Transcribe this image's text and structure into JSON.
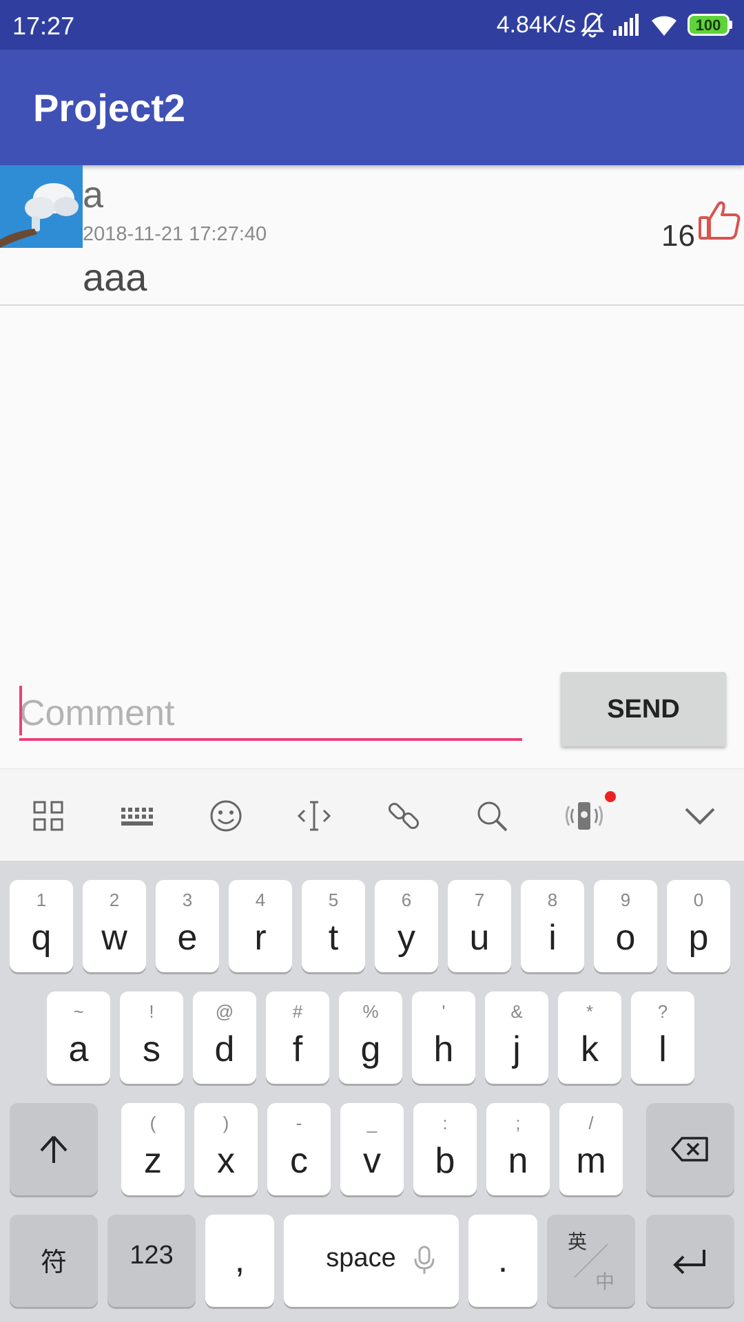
{
  "status_bar": {
    "time": "17:27",
    "net_speed": "4.84K/s",
    "battery": "100",
    "icons": [
      "mute-bell-icon",
      "signal-icon",
      "wifi-icon",
      "battery-icon"
    ]
  },
  "app_bar": {
    "title": "Project2"
  },
  "comment": {
    "user": "a",
    "time": "2018-11-21 17:27:40",
    "text": "aaa",
    "like_count": "16",
    "like_icon": "thumbs-up-icon"
  },
  "input": {
    "placeholder": "Comment",
    "value": ""
  },
  "send_button": {
    "label": "SEND"
  },
  "keyboard_toolbar": {
    "icons": [
      "grid-apps-icon",
      "keyboard-icon",
      "emoji-icon",
      "text-cursor-icon",
      "clip-link-icon",
      "search-icon",
      "phone-vibrate-icon",
      "collapse-chevron-icon"
    ]
  },
  "keyboard": {
    "row1": [
      {
        "k": "q",
        "s": "1"
      },
      {
        "k": "w",
        "s": "2"
      },
      {
        "k": "e",
        "s": "3"
      },
      {
        "k": "r",
        "s": "4"
      },
      {
        "k": "t",
        "s": "5"
      },
      {
        "k": "y",
        "s": "6"
      },
      {
        "k": "u",
        "s": "7"
      },
      {
        "k": "i",
        "s": "8"
      },
      {
        "k": "o",
        "s": "9"
      },
      {
        "k": "p",
        "s": "0"
      }
    ],
    "row2": [
      {
        "k": "a",
        "s": "~"
      },
      {
        "k": "s",
        "s": "!"
      },
      {
        "k": "d",
        "s": "@"
      },
      {
        "k": "f",
        "s": "#"
      },
      {
        "k": "g",
        "s": "%"
      },
      {
        "k": "h",
        "s": "'"
      },
      {
        "k": "j",
        "s": "&"
      },
      {
        "k": "k",
        "s": "*"
      },
      {
        "k": "l",
        "s": "?"
      }
    ],
    "row3": [
      {
        "k": "z",
        "s": "("
      },
      {
        "k": "x",
        "s": ")"
      },
      {
        "k": "c",
        "s": "-"
      },
      {
        "k": "v",
        "s": "_"
      },
      {
        "k": "b",
        "s": ":"
      },
      {
        "k": "n",
        "s": ";"
      },
      {
        "k": "m",
        "s": "/"
      }
    ],
    "row4": {
      "symbols": "符",
      "numbers": "123",
      "comma": ",",
      "space": "space",
      "period": ".",
      "lang_top": "英",
      "lang_bottom": "中"
    }
  }
}
